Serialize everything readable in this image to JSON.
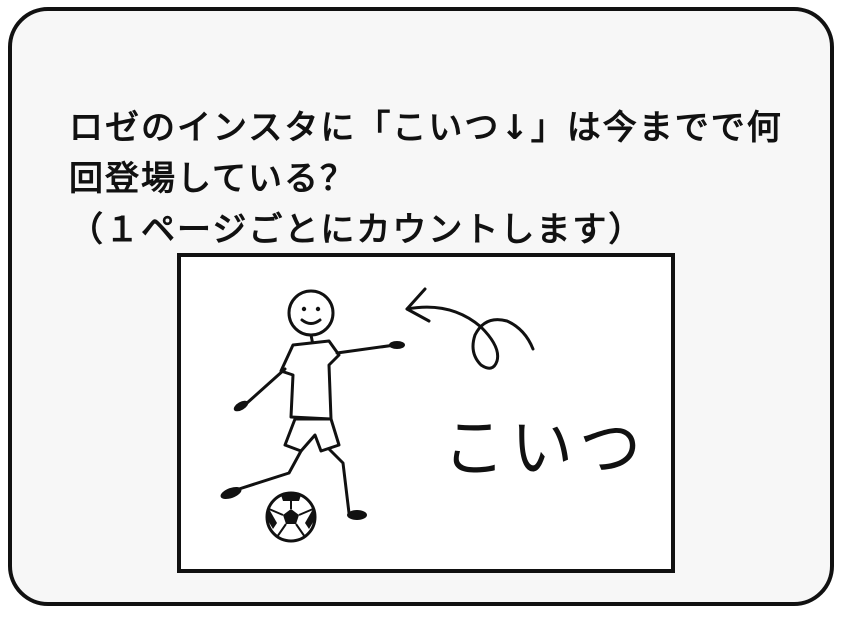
{
  "question": {
    "line1": "ロゼのインスタに「こいつ↓」は今までで何",
    "line2": "回登場している？",
    "line3": "（１ページごとにカウントします）"
  },
  "illustration": {
    "handwritten_label": "こいつ",
    "icons": [
      "stick-figure-icon",
      "soccer-ball-icon",
      "curly-arrow-icon"
    ]
  },
  "colors": {
    "ink": "#111111",
    "card_background": "#f7f7f7",
    "panel_background": "#ffffff"
  }
}
